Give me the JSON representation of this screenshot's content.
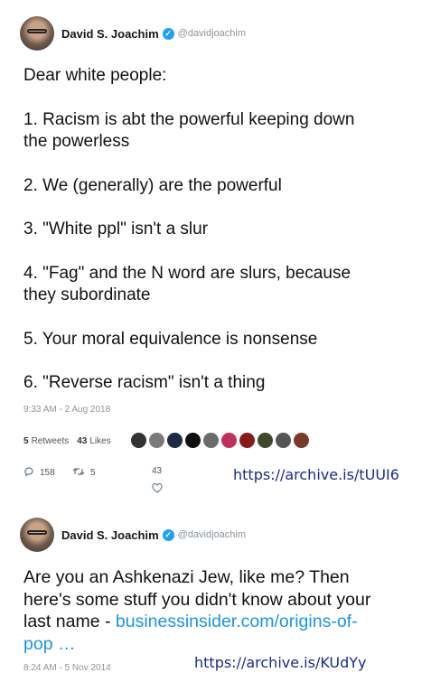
{
  "tweets": [
    {
      "author": "David S. Joachim",
      "handle": "@davidjoachim",
      "lines": [
        "Dear white people:",
        "",
        "1. Racism is abt the powerful keeping down",
        "the powerless",
        "",
        "2. We (generally) are the powerful",
        "",
        "3. \"White ppl\" isn't a slur",
        "",
        "4. \"Fag\" and the N word are slurs, because",
        "they subordinate",
        "",
        "5. Your moral equivalence is nonsense",
        "",
        "6. \"Reverse racism\" isn't a thing"
      ],
      "timestamp": "9:33 AM - 2 Aug 2018",
      "retweets_count": "5",
      "retweets_label": "Retweets",
      "likes_count": "43",
      "likes_label": "Likes",
      "liker_colors": [
        "#333333",
        "#7a7a7a",
        "#1c2a44",
        "#101010",
        "#6b6b6b",
        "#c0305a",
        "#8a1a1a",
        "#3b4a2a",
        "#555555",
        "#7a3a2a"
      ],
      "reply_count": "158",
      "retweet_action_count": "5",
      "like_action_count": "43",
      "archive_link": "https://archive.is/tUUI6"
    },
    {
      "author": "David S. Joachim",
      "handle": "@davidjoachim",
      "text_plain_1": "Are you an Ashkenazi Jew, like me? Then",
      "text_plain_2": "here's some stuff you didn't know about your",
      "text_plain_3": "last name - ",
      "text_link_1": "businessinsider.com/origins-of-",
      "text_link_2": "pop …",
      "timestamp": "8:24 AM - 5 Nov 2014",
      "archive_link": "https://archive.is/KUdYy"
    }
  ],
  "icons": {
    "verified": "verified-badge-icon",
    "reply": "reply-icon",
    "retweet": "retweet-icon",
    "like": "heart-icon"
  },
  "colors": {
    "link": "#1b95e0",
    "verified": "#1da1f2",
    "archive_text": "#1a2a8a"
  }
}
